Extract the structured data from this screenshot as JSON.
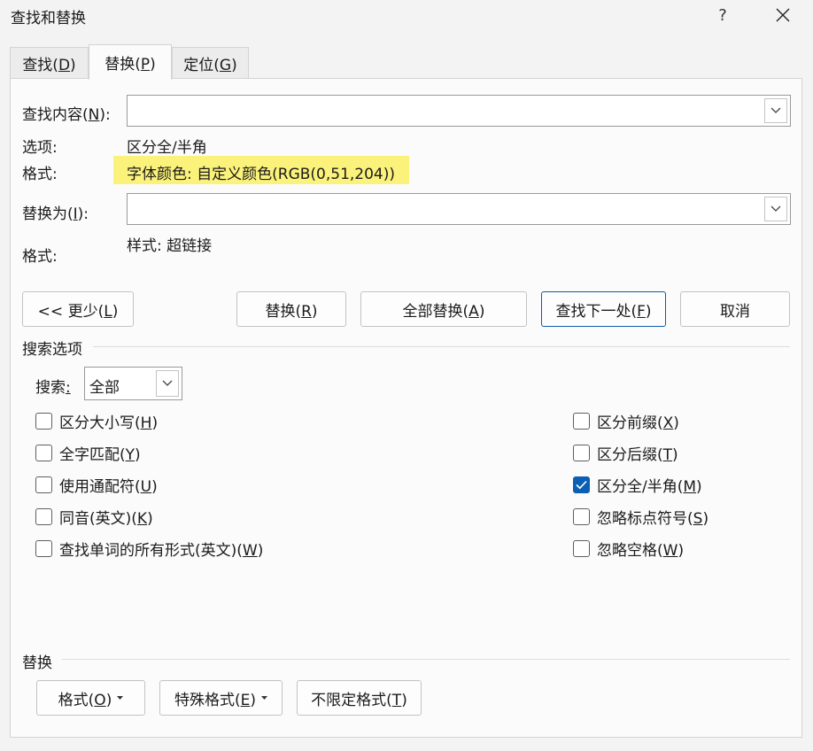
{
  "window": {
    "title": "查找和替换",
    "help": "?",
    "close_icon": "close-icon"
  },
  "tabs": [
    {
      "label": "查找(",
      "key": "D",
      "suffix": ")"
    },
    {
      "label": "替换(",
      "key": "P",
      "suffix": ")",
      "active": true
    },
    {
      "label": "定位(",
      "key": "G",
      "suffix": ")"
    }
  ],
  "find": {
    "label": "查找内容(",
    "key": "N",
    "suffix": "):",
    "value": ""
  },
  "options": {
    "label": "选项:",
    "value": "区分全/半角"
  },
  "find_format": {
    "label": "格式:",
    "value": "字体颜色: 自定义颜色(RGB(0,51,204))",
    "highlight_color": "#fbf27b"
  },
  "replace": {
    "label": "替换为(",
    "key": "I",
    "suffix": "):",
    "value": ""
  },
  "replace_format": {
    "label": "格式:",
    "value": "样式: 超链接"
  },
  "buttons": {
    "less": {
      "label": "<< 更少(",
      "key": "L",
      "suffix": ")"
    },
    "replace": {
      "label": "替换(",
      "key": "R",
      "suffix": ")"
    },
    "replace_all": {
      "label": "全部替换(",
      "key": "A",
      "suffix": ")"
    },
    "find_next": {
      "label": "查找下一处(",
      "key": "F",
      "suffix": ")"
    },
    "cancel": {
      "label": "取消"
    }
  },
  "search_options": {
    "header": "搜索选项",
    "search_label": "搜索",
    "search_colon": ":",
    "search_value": "全部",
    "left_checks": [
      {
        "label": "区分大小写(",
        "key": "H",
        "suffix": ")",
        "checked": false
      },
      {
        "label": "全字匹配(",
        "key": "Y",
        "suffix": ")",
        "checked": false
      },
      {
        "label": "使用通配符(",
        "key": "U",
        "suffix": ")",
        "checked": false
      },
      {
        "label": "同音(英文)(",
        "key": "K",
        "suffix": ")",
        "checked": false
      },
      {
        "label": "查找单词的所有形式(英文)(",
        "key": "W",
        "suffix": ")",
        "checked": false
      }
    ],
    "right_checks": [
      {
        "label": "区分前缀(",
        "key": "X",
        "suffix": ")",
        "checked": false
      },
      {
        "label": "区分后缀(",
        "key": "T",
        "suffix": ")",
        "checked": false
      },
      {
        "label": "区分全/半角(",
        "key": "M",
        "suffix": ")",
        "checked": true
      },
      {
        "label": "忽略标点符号(",
        "key": "S",
        "suffix": ")",
        "checked": false
      },
      {
        "label": "忽略空格(",
        "key": "W",
        "suffix": ")",
        "checked": false
      }
    ]
  },
  "replace_section": {
    "header": "替换",
    "format_btn": {
      "label": "格式(",
      "key": "O",
      "suffix": ")"
    },
    "special_btn": {
      "label": "特殊格式(",
      "key": "E",
      "suffix": ")"
    },
    "no_format_btn": {
      "label": "不限定格式(",
      "key": "T",
      "suffix": ")"
    }
  },
  "colors": {
    "accent": "#0a5fb4",
    "panel": "#fbfbfb",
    "background": "#f3f3f3"
  }
}
